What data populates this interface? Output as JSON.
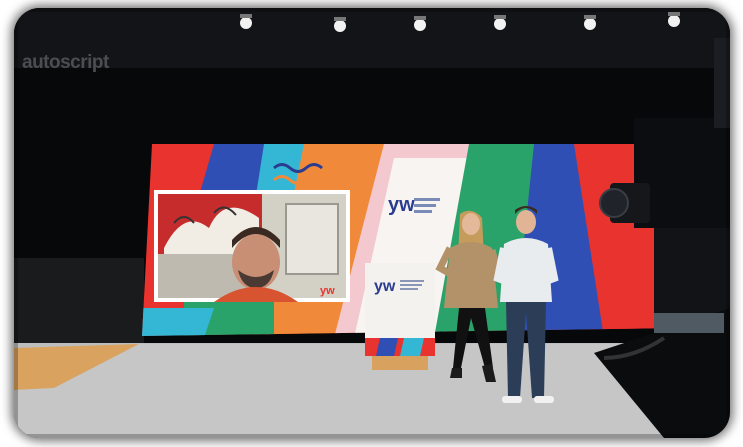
{
  "scene": {
    "description_text": {
      "backdrop_brand": "autoscript",
      "logo_mark": "yw"
    },
    "colors": {
      "dark": "#07080a",
      "red": "#e8332e",
      "blue": "#2f4fb4",
      "cyan": "#34b7d4",
      "orange": "#f08a3a",
      "pink": "#f4c8cf",
      "green": "#2aa36b",
      "white_panel": "#f7f4f1",
      "floor": "#c9c9c9",
      "wood": "#d8a25e"
    },
    "icons": [
      "stage-spotlight-icon",
      "tv-camera-icon"
    ]
  }
}
